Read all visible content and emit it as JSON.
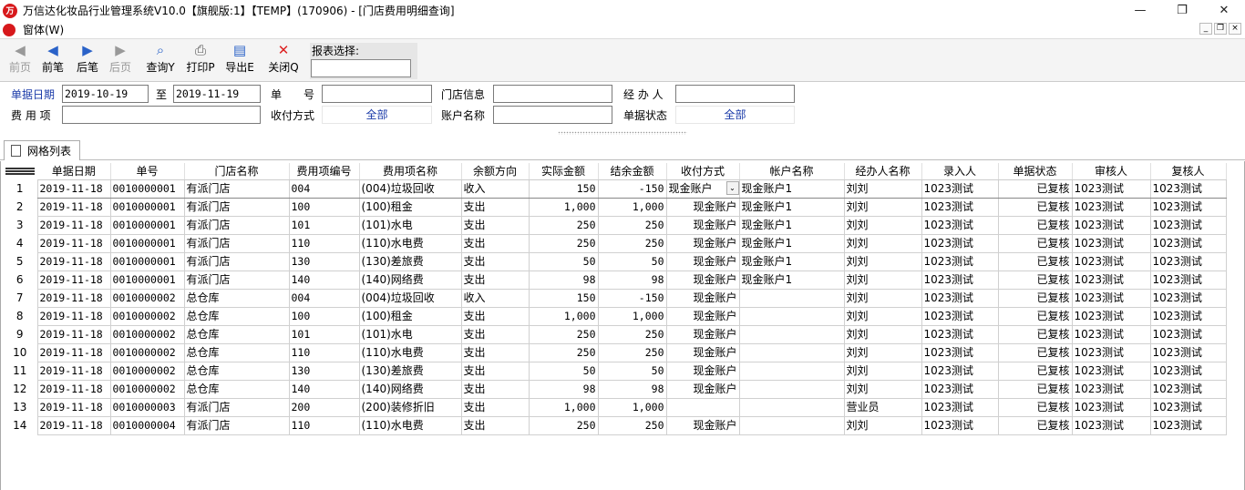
{
  "window": {
    "title": "万信达化妆品行业管理系统V10.0【旗舰版:1】【TEMP】(170906) - [门店费用明细查询]",
    "controls": [
      "—",
      "❐",
      "✕"
    ]
  },
  "menu": {
    "item": "窗体(W)"
  },
  "toolbar": {
    "buttons": [
      {
        "label": "前页",
        "icon": "first-page-icon",
        "glyph": "◀",
        "enabled": false
      },
      {
        "label": "前笔",
        "icon": "prev-record-icon",
        "glyph": "◀",
        "enabled": true
      },
      {
        "label": "后笔",
        "icon": "next-record-icon",
        "glyph": "▶",
        "enabled": true
      },
      {
        "label": "后页",
        "icon": "last-page-icon",
        "glyph": "▶",
        "enabled": false
      },
      {
        "label": "查询Y",
        "icon": "query-icon",
        "glyph": "🔍",
        "enabled": true
      },
      {
        "label": "打印P",
        "icon": "print-icon",
        "glyph": "🖶",
        "enabled": true
      },
      {
        "label": "导出E",
        "icon": "export-icon",
        "glyph": "📂",
        "enabled": true
      },
      {
        "label": "关闭Q",
        "icon": "close-icon",
        "glyph": "✕",
        "enabled": true
      }
    ],
    "report_select_label": "报表选择:",
    "report_select_value": ""
  },
  "filter": {
    "date_label": "单据日期",
    "date_from": "2019-10-19",
    "date_to_label": "至",
    "date_to": "2019-11-19",
    "doc_no_label": "单　　号",
    "doc_no": "",
    "store_label": "门店信息",
    "store": "",
    "handler_label": "经 办 人",
    "handler": "",
    "expense_label": "费 用 项",
    "expense": "",
    "payment_label": "收付方式",
    "payment": "全部",
    "account_label": "账户名称",
    "account": "",
    "status_label": "单据状态",
    "status": "全部"
  },
  "tab": {
    "label": "网格列表"
  },
  "grid": {
    "columns": [
      "单据日期",
      "单号",
      "门店名称",
      "费用项编号",
      "费用项名称",
      "余额方向",
      "实际金额",
      "结余金额",
      "收付方式",
      "帐户名称",
      "经办人名称",
      "录入人",
      "单据状态",
      "审核人",
      "复核人"
    ],
    "rows": [
      {
        "n": "1",
        "date": "2019-11-18",
        "no": "0010000001",
        "store": "有派门店",
        "code": "004",
        "name": "(004)垃圾回收",
        "dir": "收入",
        "actual": "150",
        "balance": "-150",
        "pay": "现金账户",
        "account": "现金账户1",
        "handler": "刘刘",
        "entry": "1023测试",
        "status": "已复核",
        "auditor": "1023测试",
        "reviewer": "1023测试"
      },
      {
        "n": "2",
        "date": "2019-11-18",
        "no": "0010000001",
        "store": "有派门店",
        "code": "100",
        "name": "(100)租金",
        "dir": "支出",
        "actual": "1,000",
        "balance": "1,000",
        "pay": "现金账户",
        "account": "现金账户1",
        "handler": "刘刘",
        "entry": "1023测试",
        "status": "已复核",
        "auditor": "1023测试",
        "reviewer": "1023测试"
      },
      {
        "n": "3",
        "date": "2019-11-18",
        "no": "0010000001",
        "store": "有派门店",
        "code": "101",
        "name": "(101)水电",
        "dir": "支出",
        "actual": "250",
        "balance": "250",
        "pay": "现金账户",
        "account": "现金账户1",
        "handler": "刘刘",
        "entry": "1023测试",
        "status": "已复核",
        "auditor": "1023测试",
        "reviewer": "1023测试"
      },
      {
        "n": "4",
        "date": "2019-11-18",
        "no": "0010000001",
        "store": "有派门店",
        "code": "110",
        "name": "(110)水电费",
        "dir": "支出",
        "actual": "250",
        "balance": "250",
        "pay": "现金账户",
        "account": "现金账户1",
        "handler": "刘刘",
        "entry": "1023测试",
        "status": "已复核",
        "auditor": "1023测试",
        "reviewer": "1023测试"
      },
      {
        "n": "5",
        "date": "2019-11-18",
        "no": "0010000001",
        "store": "有派门店",
        "code": "130",
        "name": "(130)差旅费",
        "dir": "支出",
        "actual": "50",
        "balance": "50",
        "pay": "现金账户",
        "account": "现金账户1",
        "handler": "刘刘",
        "entry": "1023测试",
        "status": "已复核",
        "auditor": "1023测试",
        "reviewer": "1023测试"
      },
      {
        "n": "6",
        "date": "2019-11-18",
        "no": "0010000001",
        "store": "有派门店",
        "code": "140",
        "name": "(140)网络费",
        "dir": "支出",
        "actual": "98",
        "balance": "98",
        "pay": "现金账户",
        "account": "现金账户1",
        "handler": "刘刘",
        "entry": "1023测试",
        "status": "已复核",
        "auditor": "1023测试",
        "reviewer": "1023测试"
      },
      {
        "n": "7",
        "date": "2019-11-18",
        "no": "0010000002",
        "store": "总仓库",
        "code": "004",
        "name": "(004)垃圾回收",
        "dir": "收入",
        "actual": "150",
        "balance": "-150",
        "pay": "现金账户",
        "account": "",
        "handler": "刘刘",
        "entry": "1023测试",
        "status": "已复核",
        "auditor": "1023测试",
        "reviewer": "1023测试"
      },
      {
        "n": "8",
        "date": "2019-11-18",
        "no": "0010000002",
        "store": "总仓库",
        "code": "100",
        "name": "(100)租金",
        "dir": "支出",
        "actual": "1,000",
        "balance": "1,000",
        "pay": "现金账户",
        "account": "",
        "handler": "刘刘",
        "entry": "1023测试",
        "status": "已复核",
        "auditor": "1023测试",
        "reviewer": "1023测试"
      },
      {
        "n": "9",
        "date": "2019-11-18",
        "no": "0010000002",
        "store": "总仓库",
        "code": "101",
        "name": "(101)水电",
        "dir": "支出",
        "actual": "250",
        "balance": "250",
        "pay": "现金账户",
        "account": "",
        "handler": "刘刘",
        "entry": "1023测试",
        "status": "已复核",
        "auditor": "1023测试",
        "reviewer": "1023测试"
      },
      {
        "n": "10",
        "date": "2019-11-18",
        "no": "0010000002",
        "store": "总仓库",
        "code": "110",
        "name": "(110)水电费",
        "dir": "支出",
        "actual": "250",
        "balance": "250",
        "pay": "现金账户",
        "account": "",
        "handler": "刘刘",
        "entry": "1023测试",
        "status": "已复核",
        "auditor": "1023测试",
        "reviewer": "1023测试"
      },
      {
        "n": "11",
        "date": "2019-11-18",
        "no": "0010000002",
        "store": "总仓库",
        "code": "130",
        "name": "(130)差旅费",
        "dir": "支出",
        "actual": "50",
        "balance": "50",
        "pay": "现金账户",
        "account": "",
        "handler": "刘刘",
        "entry": "1023测试",
        "status": "已复核",
        "auditor": "1023测试",
        "reviewer": "1023测试"
      },
      {
        "n": "12",
        "date": "2019-11-18",
        "no": "0010000002",
        "store": "总仓库",
        "code": "140",
        "name": "(140)网络费",
        "dir": "支出",
        "actual": "98",
        "balance": "98",
        "pay": "现金账户",
        "account": "",
        "handler": "刘刘",
        "entry": "1023测试",
        "status": "已复核",
        "auditor": "1023测试",
        "reviewer": "1023测试"
      },
      {
        "n": "13",
        "date": "2019-11-18",
        "no": "0010000003",
        "store": "有派门店",
        "code": "200",
        "name": "(200)装修折旧",
        "dir": "支出",
        "actual": "1,000",
        "balance": "1,000",
        "pay": "",
        "account": "",
        "handler": "营业员",
        "entry": "1023测试",
        "status": "已复核",
        "auditor": "1023测试",
        "reviewer": "1023测试"
      },
      {
        "n": "14",
        "date": "2019-11-18",
        "no": "0010000004",
        "store": "有派门店",
        "code": "110",
        "name": "(110)水电费",
        "dir": "支出",
        "actual": "250",
        "balance": "250",
        "pay": "现金账户",
        "account": "",
        "handler": "刘刘",
        "entry": "1023测试",
        "status": "已复核",
        "auditor": "1023测试",
        "reviewer": "1023测试"
      }
    ]
  }
}
